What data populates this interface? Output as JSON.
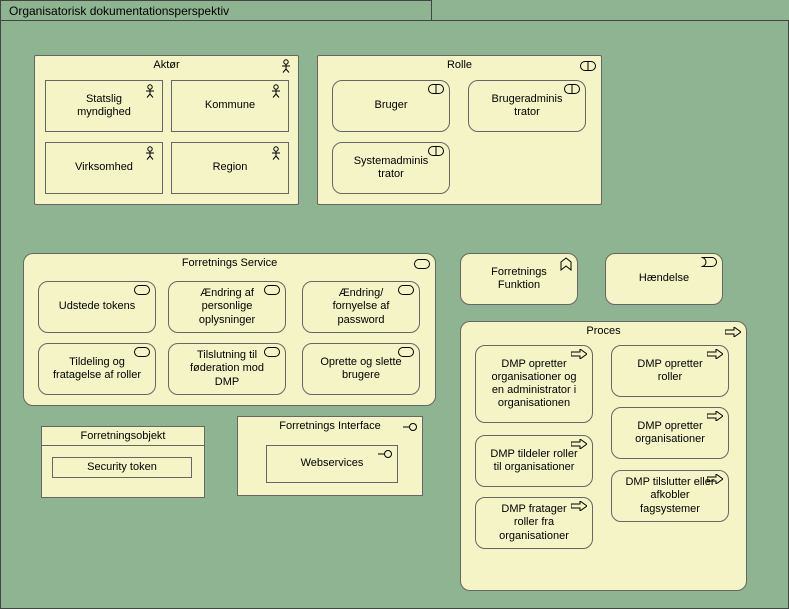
{
  "diagram": {
    "title": "Organisatorisk dokumentationsperspektiv"
  },
  "aktor": {
    "title": "Aktør",
    "statslig": "Statslig myndighed",
    "kommune": "Kommune",
    "virksomhed": "Virksomhed",
    "region": "Region"
  },
  "rolle": {
    "title": "Rolle",
    "bruger": "Bruger",
    "brugeradmin": "Brugeradminis trator",
    "sysadmin": "Systemadminis trator"
  },
  "forretningsservice": {
    "title": "Forretnings Service",
    "udstede": "Udstede tokens",
    "aendring": "Ændring af personlige oplysninger",
    "fornyelse": "Ændring/ fornyelse af password",
    "tildeling": "Tildeling og fratagelse af roller",
    "tilslutning": "Tilslutning til føderation mod DMP",
    "oprette": "Oprette og slette brugere"
  },
  "forretningsfunktion": {
    "title": "Forretnings Funktion"
  },
  "haendelse": {
    "title": "Hændelse"
  },
  "proces": {
    "title": "Proces",
    "p1": "DMP opretter organisationer og en administrator i organisationen",
    "p2": "DMP opretter roller",
    "p3": "DMP opretter organisationer",
    "p4": "DMP tildeler roller til organisationer",
    "p5": "DMP tilslutter eller afkobler fagsystemer",
    "p6": "DMP fratager roller fra organisationer"
  },
  "forretningsobjekt": {
    "title": "Forretningsobjekt",
    "security": "Security token"
  },
  "forretningsinterface": {
    "title": "Forretnings Interface",
    "webservices": "Webservices"
  }
}
